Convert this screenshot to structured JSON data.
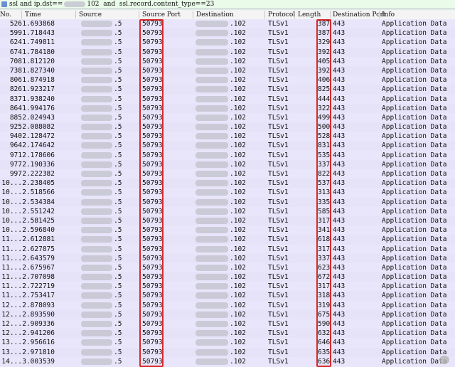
{
  "filter": {
    "prefix": "ssl and ip.dst==",
    "suffix": "102  and  ssl.record.content_type==23"
  },
  "columns": {
    "no": "No.",
    "time": "Time",
    "source": "Source",
    "src_port": "Source Port",
    "destination": "Destination",
    "protocol": "Protocol",
    "length": "Length",
    "dst_port": "Destination Port",
    "info": "Info"
  },
  "row_defaults": {
    "source_suffix": ".5",
    "src_port": "50793",
    "destination_suffix": ".102",
    "protocol": "TLSv1",
    "dst_port": "443",
    "info": "Application Data"
  },
  "rows": [
    {
      "no": "526",
      "time": "1.693868",
      "length": "387"
    },
    {
      "no": "599",
      "time": "1.718443",
      "length": "387"
    },
    {
      "no": "624",
      "time": "1.749811",
      "length": "329"
    },
    {
      "no": "674",
      "time": "1.784180",
      "length": "392"
    },
    {
      "no": "708",
      "time": "1.812120",
      "length": "405"
    },
    {
      "no": "738",
      "time": "1.827340",
      "length": "392"
    },
    {
      "no": "806",
      "time": "1.874918",
      "length": "406"
    },
    {
      "no": "826",
      "time": "1.923217",
      "length": "825"
    },
    {
      "no": "837",
      "time": "1.938240",
      "length": "444"
    },
    {
      "no": "864",
      "time": "1.994176",
      "length": "322"
    },
    {
      "no": "885",
      "time": "2.024943",
      "length": "499"
    },
    {
      "no": "925",
      "time": "2.088082",
      "length": "500"
    },
    {
      "no": "940",
      "time": "2.128472",
      "length": "528"
    },
    {
      "no": "964",
      "time": "2.174642",
      "length": "831"
    },
    {
      "no": "971",
      "time": "2.178606",
      "length": "535"
    },
    {
      "no": "977",
      "time": "2.190336",
      "length": "337"
    },
    {
      "no": "997",
      "time": "2.222382",
      "length": "822"
    },
    {
      "no": "10...",
      "time": "2.238405",
      "length": "537"
    },
    {
      "no": "10...",
      "time": "2.518566",
      "length": "313"
    },
    {
      "no": "10...",
      "time": "2.534384",
      "length": "335"
    },
    {
      "no": "10...",
      "time": "2.551242",
      "length": "585"
    },
    {
      "no": "10...",
      "time": "2.581425",
      "length": "317"
    },
    {
      "no": "10...",
      "time": "2.596840",
      "length": "341"
    },
    {
      "no": "11...",
      "time": "2.612881",
      "length": "618"
    },
    {
      "no": "11...",
      "time": "2.627875",
      "length": "317"
    },
    {
      "no": "11...",
      "time": "2.643579",
      "length": "337"
    },
    {
      "no": "11...",
      "time": "2.675967",
      "length": "623"
    },
    {
      "no": "11...",
      "time": "2.707098",
      "length": "672"
    },
    {
      "no": "11...",
      "time": "2.722719",
      "length": "317"
    },
    {
      "no": "11...",
      "time": "2.753417",
      "length": "318"
    },
    {
      "no": "12...",
      "time": "2.878093",
      "length": "319"
    },
    {
      "no": "12...",
      "time": "2.893590",
      "length": "675"
    },
    {
      "no": "12...",
      "time": "2.909336",
      "length": "590"
    },
    {
      "no": "12...",
      "time": "2.941206",
      "length": "632"
    },
    {
      "no": "13...",
      "time": "2.956616",
      "length": "646"
    },
    {
      "no": "13...",
      "time": "2.971810",
      "length": "635"
    },
    {
      "no": "14...",
      "time": "3.003539",
      "length": "636"
    }
  ]
}
